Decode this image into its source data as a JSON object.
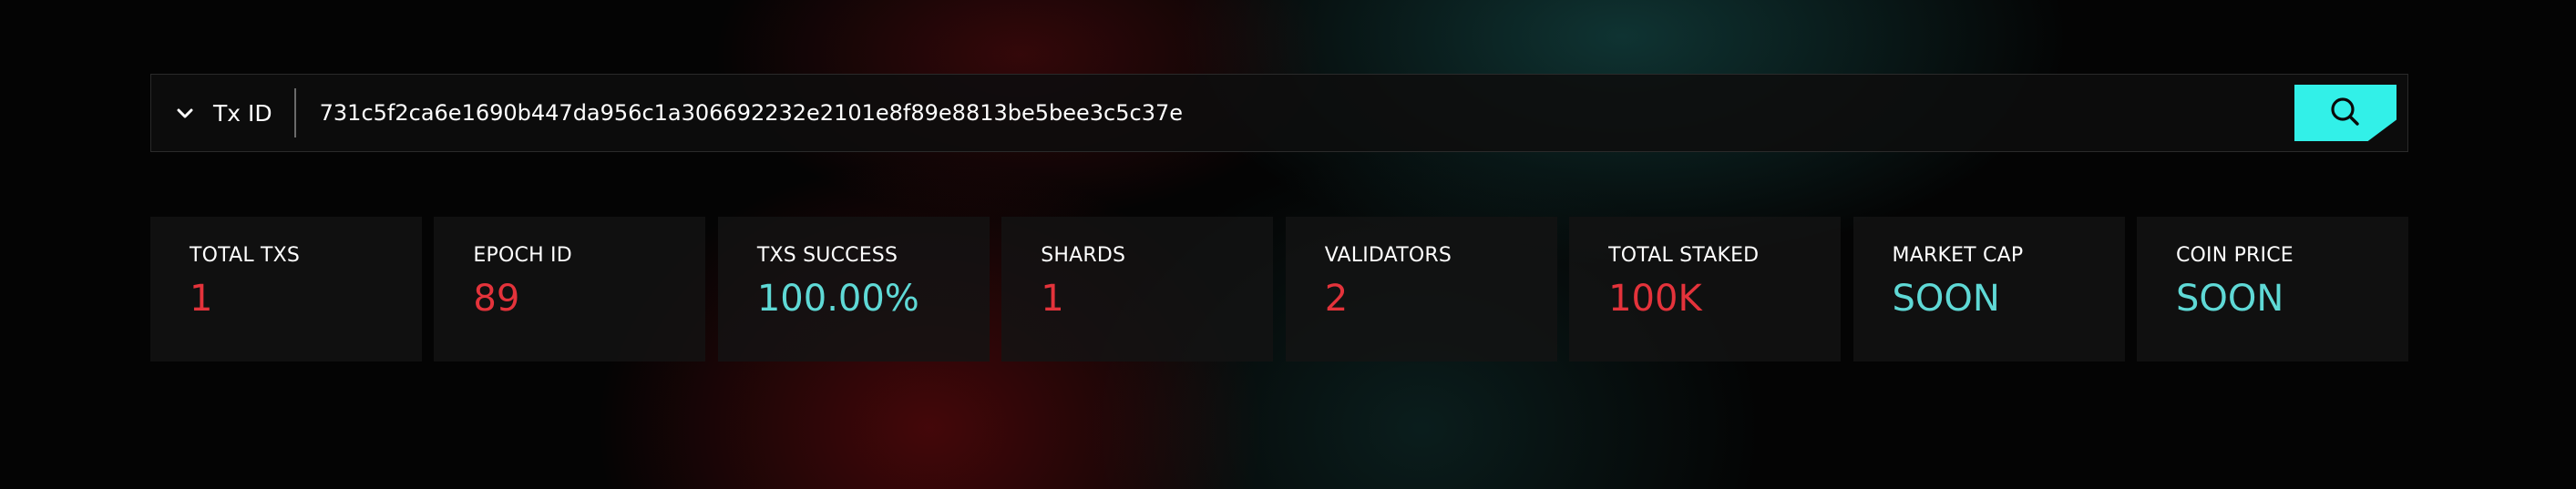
{
  "search": {
    "type_label": "Tx ID",
    "value": "731c5f2ca6e1690b447da956c1a306692232e2101e8f89e8813be5bee3c5c37e",
    "chevron_icon": "chevron-down-icon",
    "search_icon": "search-icon"
  },
  "colors": {
    "accent": "#32f0e8",
    "value_red": "#e4333b",
    "value_teal": "#5fd9d6"
  },
  "stats": [
    {
      "label": "TOTAL TXS",
      "value": "1",
      "color": "red"
    },
    {
      "label": "EPOCH ID",
      "value": "89",
      "color": "red"
    },
    {
      "label": "TXS SUCCESS",
      "value": "100.00%",
      "color": "teal"
    },
    {
      "label": "SHARDS",
      "value": "1",
      "color": "red"
    },
    {
      "label": "VALIDATORS",
      "value": "2",
      "color": "red"
    },
    {
      "label": "TOTAL STAKED",
      "value": "100K",
      "color": "red"
    },
    {
      "label": "MARKET CAP",
      "value": "SOON",
      "color": "teal"
    },
    {
      "label": "COIN PRICE",
      "value": "SOON",
      "color": "teal"
    }
  ]
}
